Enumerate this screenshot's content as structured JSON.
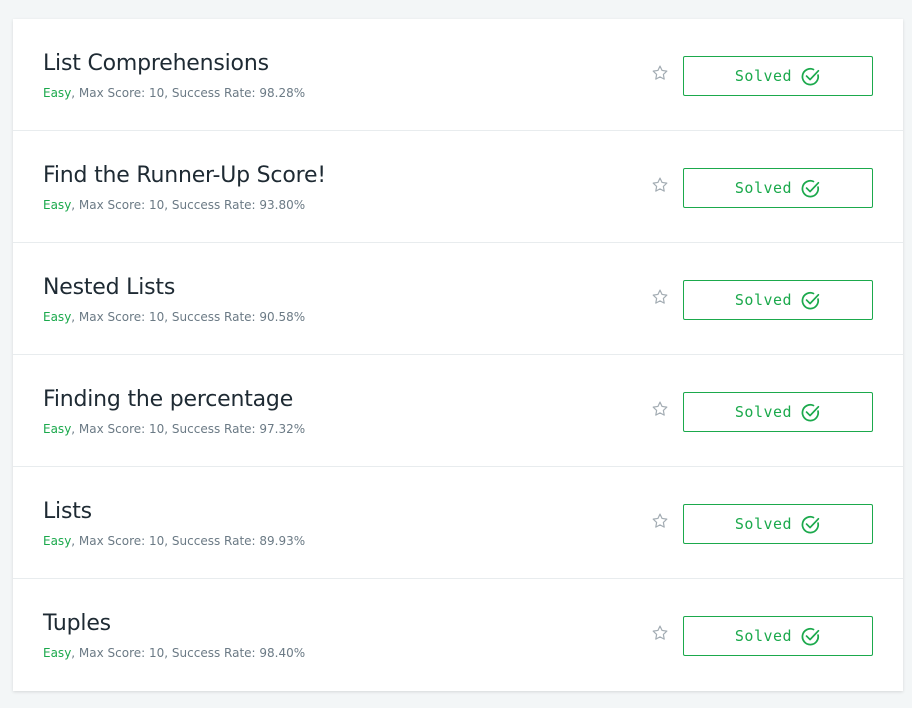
{
  "challenges": [
    {
      "title": "List Comprehensions",
      "difficulty": "Easy",
      "details": ", Max Score: 10, Success Rate: 98.28%",
      "status_label": "Solved"
    },
    {
      "title": "Find the Runner-Up Score!",
      "difficulty": "Easy",
      "details": ", Max Score: 10, Success Rate: 93.80%",
      "status_label": "Solved"
    },
    {
      "title": "Nested Lists",
      "difficulty": "Easy",
      "details": ", Max Score: 10, Success Rate: 90.58%",
      "status_label": "Solved"
    },
    {
      "title": "Finding the percentage",
      "difficulty": "Easy",
      "details": ", Max Score: 10, Success Rate: 97.32%",
      "status_label": "Solved"
    },
    {
      "title": "Lists",
      "difficulty": "Easy",
      "details": ", Max Score: 10, Success Rate: 89.93%",
      "status_label": "Solved"
    },
    {
      "title": "Tuples",
      "difficulty": "Easy",
      "details": ", Max Score: 10, Success Rate: 98.40%",
      "status_label": "Solved"
    }
  ],
  "icons": {
    "bookmark": "star-outline-icon",
    "solved": "check-circle-icon"
  },
  "colors": {
    "accent": "#1ba94c",
    "title": "#1e2a33",
    "meta": "#6b7a85",
    "star": "#a3acb3"
  }
}
